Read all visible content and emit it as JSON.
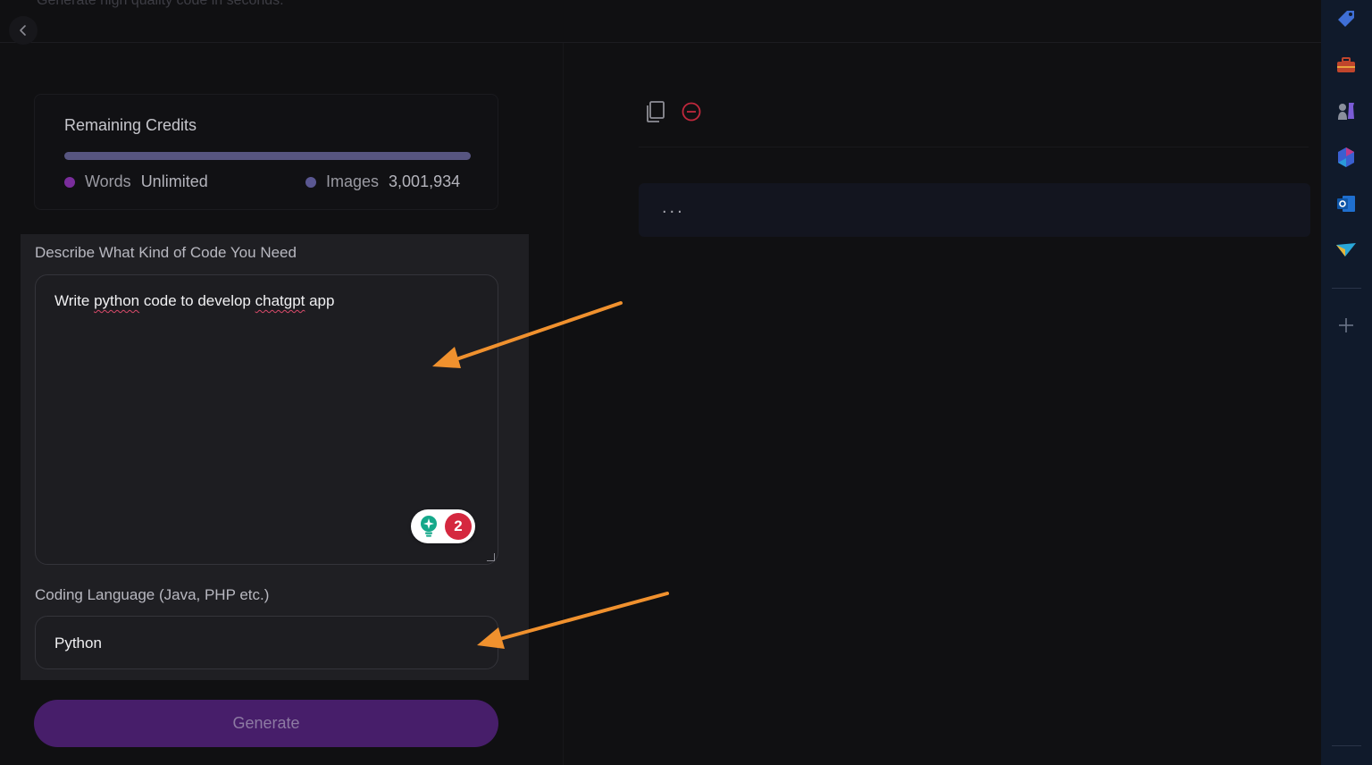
{
  "header": {
    "subtitle": "Generate high quality code in seconds."
  },
  "credits": {
    "title": "Remaining Credits",
    "words_label": "Words",
    "words_value": "Unlimited",
    "images_label": "Images",
    "images_value": "3,001,934",
    "colors": {
      "words_dot": "#7a2d9c",
      "images_dot": "#5a5792",
      "bar": "#575580"
    }
  },
  "form": {
    "description_label": "Describe What Kind of Code You Need",
    "description_value": {
      "p1": "Write ",
      "w1": "python",
      "p2": " code to develop ",
      "w2": "chatgpt",
      "p3": " app"
    },
    "grammar_badge_count": "2",
    "language_label": "Coding Language (Java, PHP etc.)",
    "language_value": "Python",
    "generate_label": "Generate"
  },
  "output": {
    "placeholder": "..."
  },
  "sidebar": {
    "icons": [
      "tag-icon",
      "toolbox-icon",
      "chess-icon",
      "copilot-icon",
      "outlook-icon",
      "paper-plane-icon",
      "plus-icon"
    ]
  },
  "annotation": {
    "arrow_color": "#f0912e"
  }
}
